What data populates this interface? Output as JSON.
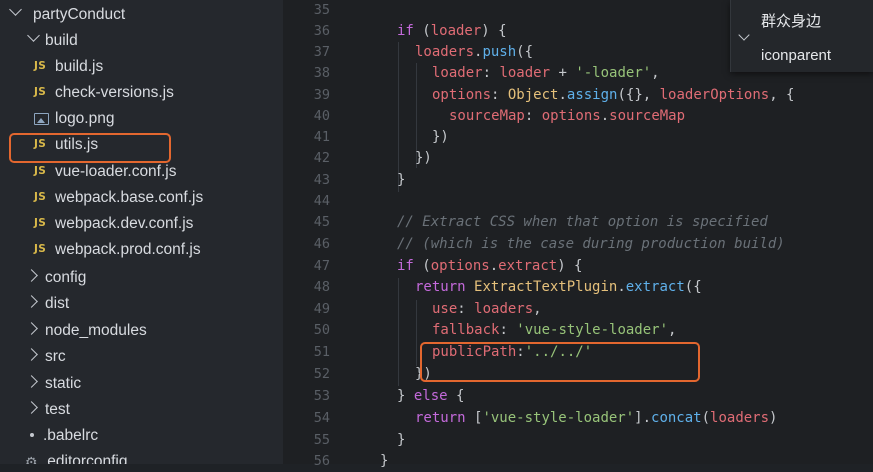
{
  "explorer": {
    "root": "partyConduct",
    "build_folder": "build",
    "build_files": [
      {
        "name": "build.js",
        "icon": "JS"
      },
      {
        "name": "check-versions.js",
        "icon": "JS"
      },
      {
        "name": "logo.png",
        "icon": "image"
      },
      {
        "name": "utils.js",
        "icon": "JS"
      },
      {
        "name": "vue-loader.conf.js",
        "icon": "JS"
      },
      {
        "name": "webpack.base.conf.js",
        "icon": "JS"
      },
      {
        "name": "webpack.dev.conf.js",
        "icon": "JS"
      },
      {
        "name": "webpack.prod.conf.js",
        "icon": "JS"
      }
    ],
    "folders": [
      "config",
      "dist",
      "node_modules",
      "src",
      "static",
      "test"
    ],
    "dotfiles": [
      ".babelrc",
      ".editorconfig"
    ],
    "js_badge": "JS"
  },
  "dropdown": {
    "items": [
      "群众身边",
      "iconparent"
    ]
  },
  "editor": {
    "line_numbers": [
      "35",
      "36",
      "37",
      "38",
      "39",
      "40",
      "41",
      "42",
      "43",
      "44",
      "45",
      "46",
      "47",
      "48",
      "49",
      "50",
      "51",
      "52",
      "53",
      "54",
      "55",
      "56"
    ],
    "lines": {
      "l36": [
        "if",
        " (",
        "loader",
        ") {"
      ],
      "l37": [
        "loaders",
        ".",
        "push",
        "({"
      ],
      "l38": [
        "loader",
        ": ",
        "loader",
        " + ",
        "'-loader'",
        ","
      ],
      "l39": [
        "options",
        ": ",
        "Object",
        ".",
        "assign",
        "({}, ",
        "loaderOptions",
        ", {"
      ],
      "l40": [
        "sourceMap",
        ": ",
        "options",
        ".",
        "sourceMap"
      ],
      "l41": [
        "})"
      ],
      "l42": [
        "})"
      ],
      "l43": [
        "}"
      ],
      "l45": [
        "// Extract CSS when that option is specified"
      ],
      "l46": [
        "// (which is the case during production build)"
      ],
      "l47": [
        "if",
        " (",
        "options",
        ".",
        "extract",
        ") {"
      ],
      "l48": [
        "return",
        " ",
        "ExtractTextPlugin",
        ".",
        "extract",
        "({"
      ],
      "l49": [
        "use",
        ": ",
        "loaders",
        ","
      ],
      "l50": [
        "fallback",
        ": ",
        "'vue-style-loader'",
        ","
      ],
      "l51": [
        "publicPath",
        ":",
        "'../../'"
      ],
      "l52": [
        "})"
      ],
      "l53": [
        "} ",
        "else",
        " {"
      ],
      "l54": [
        "return",
        " [",
        "'vue-style-loader'",
        "].",
        "concat",
        "(",
        "loaders",
        ")"
      ],
      "l55": [
        "}"
      ],
      "l56": [
        "}"
      ]
    }
  },
  "colors": {
    "highlight": "#e3672f",
    "keyword": "#c46adb",
    "string": "#97c379",
    "function": "#5fb0ea",
    "variable": "#e06c75"
  }
}
